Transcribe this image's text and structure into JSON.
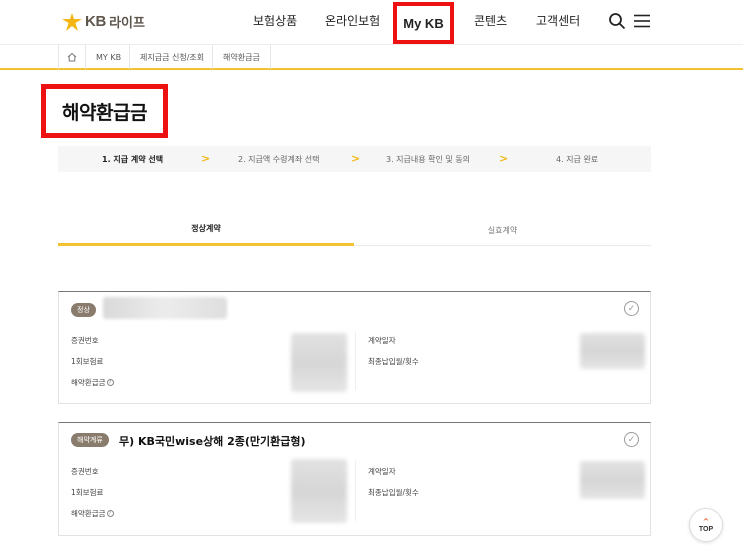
{
  "header": {
    "logo_kb": "KB",
    "logo_life": "라이프",
    "nav": [
      {
        "label": "보험상품"
      },
      {
        "label": "온라인보험"
      },
      {
        "label": "My KB"
      },
      {
        "label": "콘텐츠"
      },
      {
        "label": "고객센터"
      }
    ]
  },
  "breadcrumb": [
    "MY KB",
    "제지급금 신청/조회",
    "해약환급금"
  ],
  "page_title": "해약환급금",
  "steps": [
    {
      "label": "1. 지급 계약 선택"
    },
    {
      "label": "2. 지급액 수령계좌 선택"
    },
    {
      "label": "3. 지급내용 확인 및 동의"
    },
    {
      "label": "4. 지급 완료"
    }
  ],
  "tabs": [
    {
      "label": "정상계약"
    },
    {
      "label": "실효계약"
    }
  ],
  "cards": [
    {
      "badge": "정상",
      "title": "",
      "labels": {
        "policy_no": "증권번호",
        "first_premium": "1회보험료",
        "surrender": "해약환급금",
        "contract_date": "계약일자",
        "last_payment": "최종납입월/횟수"
      }
    },
    {
      "badge": "해약계류",
      "title": "무) KB국민wise상해 2종(만기환급형)",
      "labels": {
        "policy_no": "증권번호",
        "first_premium": "1회보험료",
        "surrender": "해약환급금",
        "contract_date": "계약일자",
        "last_payment": "최종납입월/횟수"
      }
    }
  ],
  "top_button": "TOP",
  "icons": {
    "home": "home-icon",
    "search": "search-icon",
    "menu": "hamburger-menu-icon",
    "check": "check-circle-icon",
    "info": "info-icon"
  },
  "colors": {
    "accent": "#f2c230",
    "highlight_box": "#ee1111",
    "badge": "#8a7c6d"
  }
}
